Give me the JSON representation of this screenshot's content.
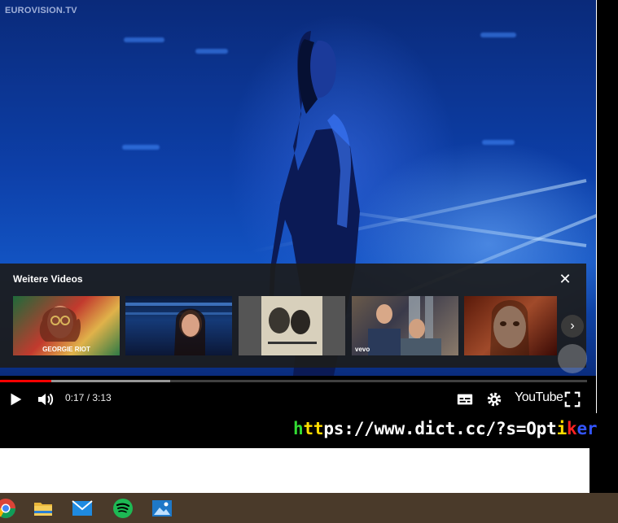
{
  "video": {
    "watermark": "EUROVISION.TV",
    "played_fraction": 0.087,
    "buffered_fraction": 0.29
  },
  "more_videos": {
    "title": "Weitere Videos",
    "thumbnails": [
      {
        "caption": "GEORGIE RIOT"
      },
      {
        "caption": ""
      },
      {
        "caption": ""
      },
      {
        "caption": "vevo"
      },
      {
        "caption": ""
      }
    ]
  },
  "controls": {
    "time": "0:17 / 3:13",
    "logo": "YouTube"
  },
  "url": {
    "text_parts": [
      {
        "t": "h",
        "color": "#33dd33"
      },
      {
        "t": "t",
        "color": "#ffdd00"
      },
      {
        "t": "t",
        "color": "#ffdd00"
      },
      {
        "t": "ps://www.dict.cc/?s=Opt",
        "color": "#ffffff"
      },
      {
        "t": "i",
        "color": "#ffdd00"
      },
      {
        "t": "k",
        "color": "#ff2222"
      },
      {
        "t": "er",
        "color": "#3355ff"
      }
    ]
  },
  "taskbar": {
    "icons": [
      "chrome-icon",
      "file-explorer-icon",
      "mail-icon",
      "spotify-icon",
      "photos-icon"
    ]
  }
}
